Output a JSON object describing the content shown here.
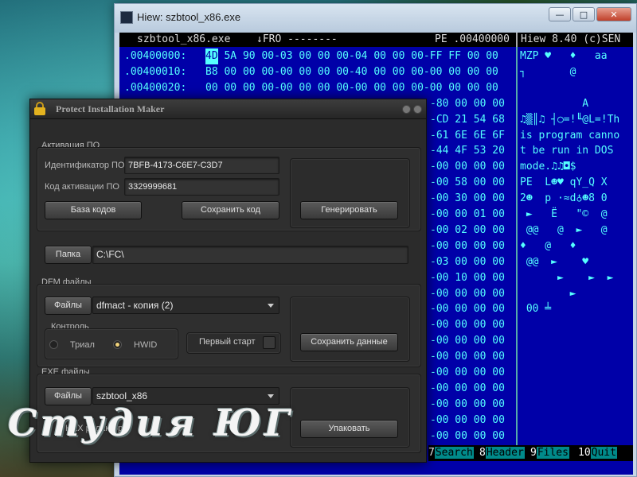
{
  "hiew": {
    "window_title": "Hiew: szbtool_x86.exe",
    "header": {
      "filename": "szbtool_x86.exe",
      "mode": "↓FRO --------",
      "offset": "PE .00400000",
      "version": "Hiew 8.40 (c)SEN"
    },
    "rows": [
      {
        "addr": ".00400000:",
        "hex": "4D 5A 90 00-03 00 00 00-04 00 00 00-FF FF 00 00",
        "text": "MZP ♥   ♦   aa"
      },
      {
        "addr": ".00400010:",
        "hex": "B8 00 00 00-00 00 00 00-40 00 00 00-00 00 00 00",
        "text": "┐       @"
      },
      {
        "addr": ".00400020:",
        "hex": "00 00 00 00-00 00 00 00-00 00 00 00-00 00 00 00",
        "text": ""
      },
      {
        "addr": "",
        "hex": "-80 00 00 00",
        "text": "          A"
      },
      {
        "addr": "",
        "hex": "-CD 21 54 68",
        "text": "♫▒║♫ ┤○=!╙@L=!Th"
      },
      {
        "addr": "",
        "hex": "-61 6E 6E 6F",
        "text": "is program canno"
      },
      {
        "addr": "",
        "hex": "-44 4F 53 20",
        "text": "t be run in DOS"
      },
      {
        "addr": "",
        "hex": "-00 00 00 00",
        "text": "mode.♫♫◘$"
      },
      {
        "addr": "",
        "hex": "-00 58 00 00",
        "text": "PE  L☻♥ qY_Q X"
      },
      {
        "addr": "",
        "hex": "-00 30 00 00",
        "text": "2☻  p ·≈d♁☻8 0"
      },
      {
        "addr": "",
        "hex": "-00 00 01 00",
        "text": " ►   Ë   \"©  @"
      },
      {
        "addr": "",
        "hex": "-00 02 00 00",
        "text": " @@   @  ►   @"
      },
      {
        "addr": "",
        "hex": "-00 00 00 00",
        "text": "♦   @   ♦"
      },
      {
        "addr": "",
        "hex": "-03 00 00 00",
        "text": " @@  ►    ♥"
      },
      {
        "addr": "",
        "hex": "-00 10 00 00",
        "text": "      ►    ►  ►"
      },
      {
        "addr": "",
        "hex": "-00 00 00 00",
        "text": "        ►"
      },
      {
        "addr": "",
        "hex": "-00 00 00 00",
        "text": " 00 ╧"
      },
      {
        "addr": "",
        "hex": "-00 00 00 00",
        "text": ""
      },
      {
        "addr": "",
        "hex": "-00 00 00 00",
        "text": ""
      },
      {
        "addr": "",
        "hex": "-00 00 00 00",
        "text": ""
      },
      {
        "addr": "",
        "hex": "-00 00 00 00",
        "text": ""
      },
      {
        "addr": "",
        "hex": "-00 00 00 00",
        "text": ""
      },
      {
        "addr": "",
        "hex": "-00 00 00 00",
        "text": ""
      },
      {
        "addr": "",
        "hex": "-00 00 00 00",
        "text": ""
      },
      {
        "addr": "",
        "hex": "-00 00 00 00",
        "text": ""
      }
    ],
    "fkeys": [
      {
        "num": "7",
        "label": "Search"
      },
      {
        "num": "8",
        "label": "Header"
      },
      {
        "num": "9",
        "label": "Files"
      },
      {
        "num": "10",
        "label": "Quit"
      }
    ]
  },
  "pim": {
    "window_title": "Protect Installation Maker",
    "activation": {
      "group_label": "Активация ПО",
      "id_label": "Идентификатор ПО",
      "id_value": "7BFB-4173-C6E7-C3D7",
      "code_label": "Код активации ПО",
      "code_value": "3329999681",
      "db_button": "База кодов",
      "save_code_button": "Сохранить код",
      "generate_button": "Генерировать"
    },
    "folder": {
      "button": "Папка",
      "path": "C:\\FC\\"
    },
    "dfm": {
      "group_label": "DFM файлы",
      "files_button": "Файлы",
      "selected": "dfmact - копия (2)",
      "control_label": "Контроль",
      "trial_label": "Триал",
      "hwid_label": "HWID",
      "first_start_label": "Первый старт",
      "save_data_button": "Сохранить данные"
    },
    "exe": {
      "group_label": "EXE файлы",
      "files_button": "Файлы",
      "selected": "szbtool_x86",
      "hex_editor_label": "HEX редактор",
      "pack_button": "Упаковать"
    }
  },
  "watermark": "Студия ЮГ",
  "colors": {
    "hiew_bg": "#0000a8",
    "hiew_fg": "#55ffff",
    "dialog_bg": "#2b2b2b",
    "accent_radio": "#f0d27a"
  }
}
